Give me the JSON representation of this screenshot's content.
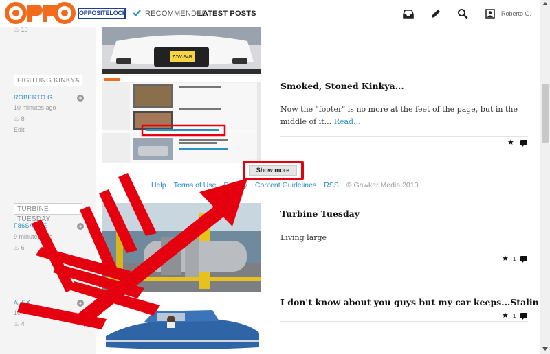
{
  "header": {
    "logo_text": "OPPO",
    "brand": "OPPOSITELOCK",
    "nav_recommended": "RECOMMENDED",
    "nav_latest": "LATEST POSTS",
    "user_name": "Roberto G."
  },
  "posts": [
    {
      "likes": "10"
    },
    {
      "tag": "FIGHTING KINKYA",
      "author": "ROBERTO G.",
      "time": "10 minutes ago",
      "likes": "8",
      "edit": "Edit",
      "title": "Smoked, Stoned Kinkya...",
      "body": "Now the \"footer\" is no more at the feet of the page, but in the middle of it...",
      "read_more": "Read..."
    },
    {
      "tag": "TURBINE TUESDAY",
      "author": "F86SABRE",
      "time": "9 minutes ago",
      "likes": "6",
      "title": "Turbine Tuesday",
      "body": "Living large",
      "star_count": "1"
    },
    {
      "author": "ALEX",
      "time": "10 minutes ago",
      "likes": "4",
      "title": "I don't know about you guys but my car keeps...Stalin!",
      "star_count": "1"
    }
  ],
  "license_plate": "ZJW·94B",
  "footer": {
    "help": "Help",
    "terms": "Terms of Use",
    "privacy": "Privacy",
    "guidelines": "Content Guidelines",
    "rss": "RSS",
    "copyright": "© Gawker Media 2013"
  },
  "show_more": "Show more",
  "colors": {
    "accent_orange": "#f26a1b",
    "brand_blue": "#1d3f95",
    "link_blue": "#2d8fc4",
    "annotation_red": "#e4000f"
  }
}
